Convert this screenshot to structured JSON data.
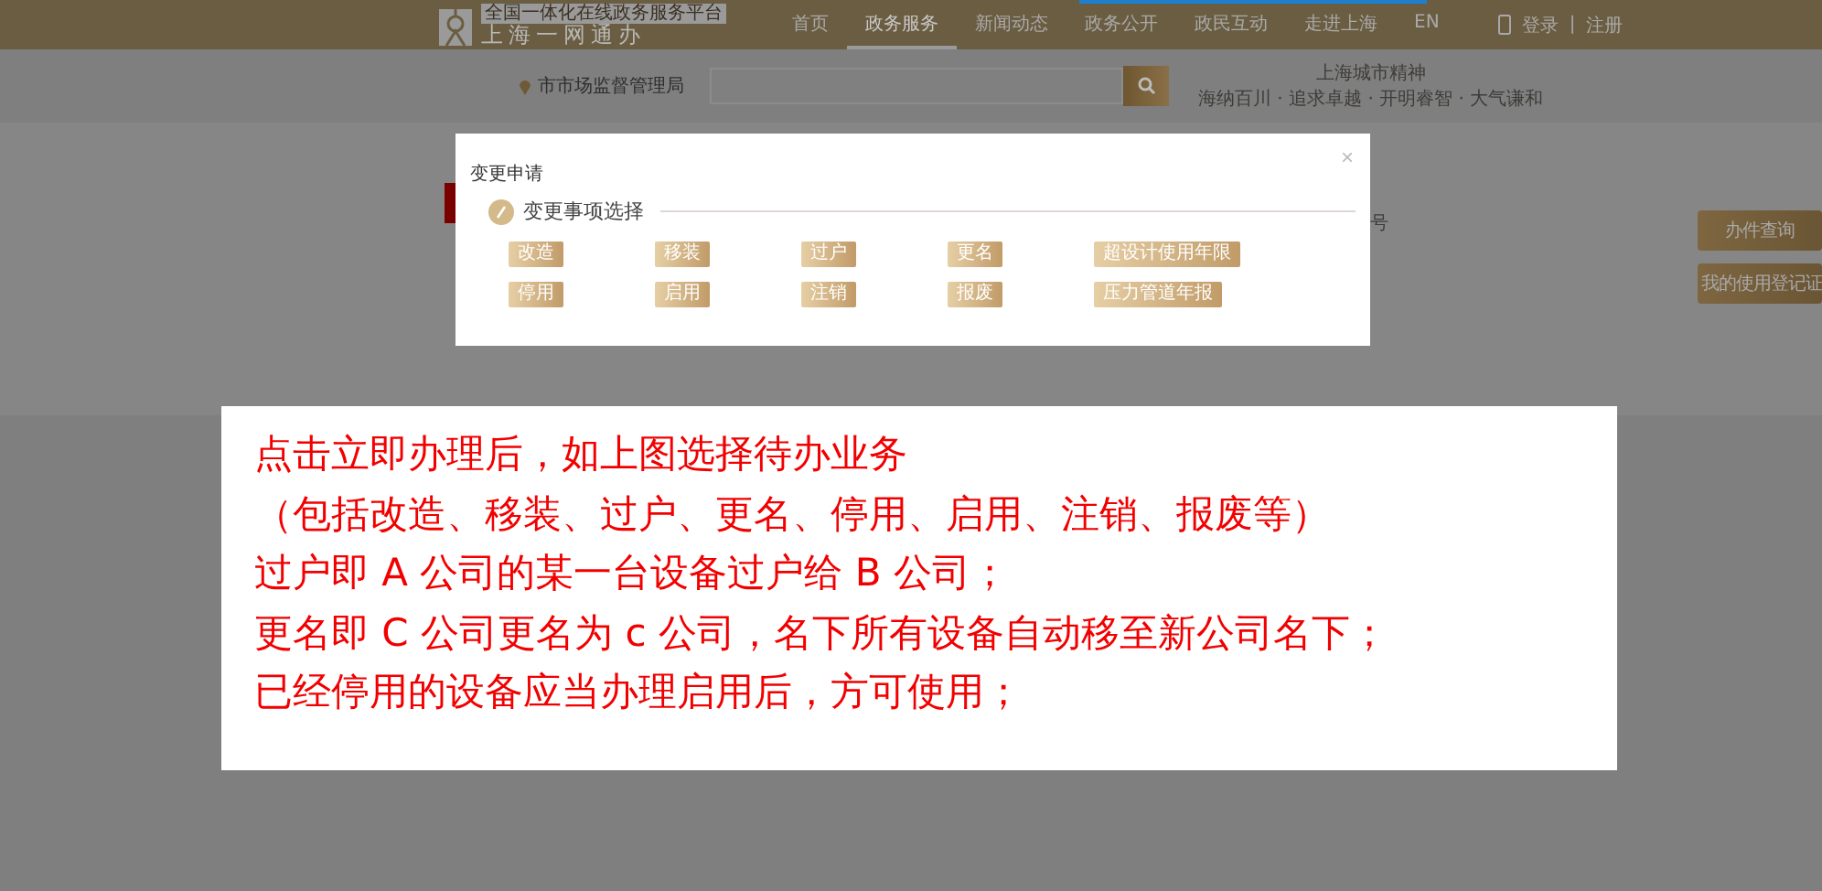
{
  "header": {
    "tagline": "全国一体化在线政务服务平台",
    "site_name": "上海一网通办",
    "nav": [
      {
        "label": "首页",
        "selected": false
      },
      {
        "label": "政务服务",
        "selected": true
      },
      {
        "label": "新闻动态",
        "selected": false
      },
      {
        "label": "政务公开",
        "selected": false
      },
      {
        "label": "政民互动",
        "selected": false
      },
      {
        "label": "走进上海",
        "selected": false
      },
      {
        "label": "EN",
        "selected": false
      }
    ],
    "login": "登录",
    "divider": "|",
    "register": "注册"
  },
  "search": {
    "location": "市市场监督管理局",
    "motto": "上海城市精神",
    "motto_sub": "海纳百川 · 追求卓越 · 开明睿智 · 大气谦和"
  },
  "background": {
    "partial_text": "号",
    "side_buttons": [
      "办件查询",
      "我的使用登记证"
    ]
  },
  "dialog": {
    "title": "变更申请",
    "close": "×",
    "section": "变更事项选择",
    "options": [
      [
        "改造",
        "移装",
        "过户",
        "更名",
        "超设计使用年限"
      ],
      [
        "停用",
        "启用",
        "注销",
        "报废",
        "压力管道年报"
      ]
    ]
  },
  "note": {
    "lines": [
      "点击立即办理后，如上图选择待办业务",
      "（包括改造、移装、过户、更名、停用、启用、注销、报废等）",
      "过户即 A 公司的某一台设备过户给 B 公司；",
      "更名即 C 公司更名为 c 公司，名下所有设备自动移至新公司名下；",
      "已经停用的设备应当办理启用后，方可使用；"
    ]
  }
}
